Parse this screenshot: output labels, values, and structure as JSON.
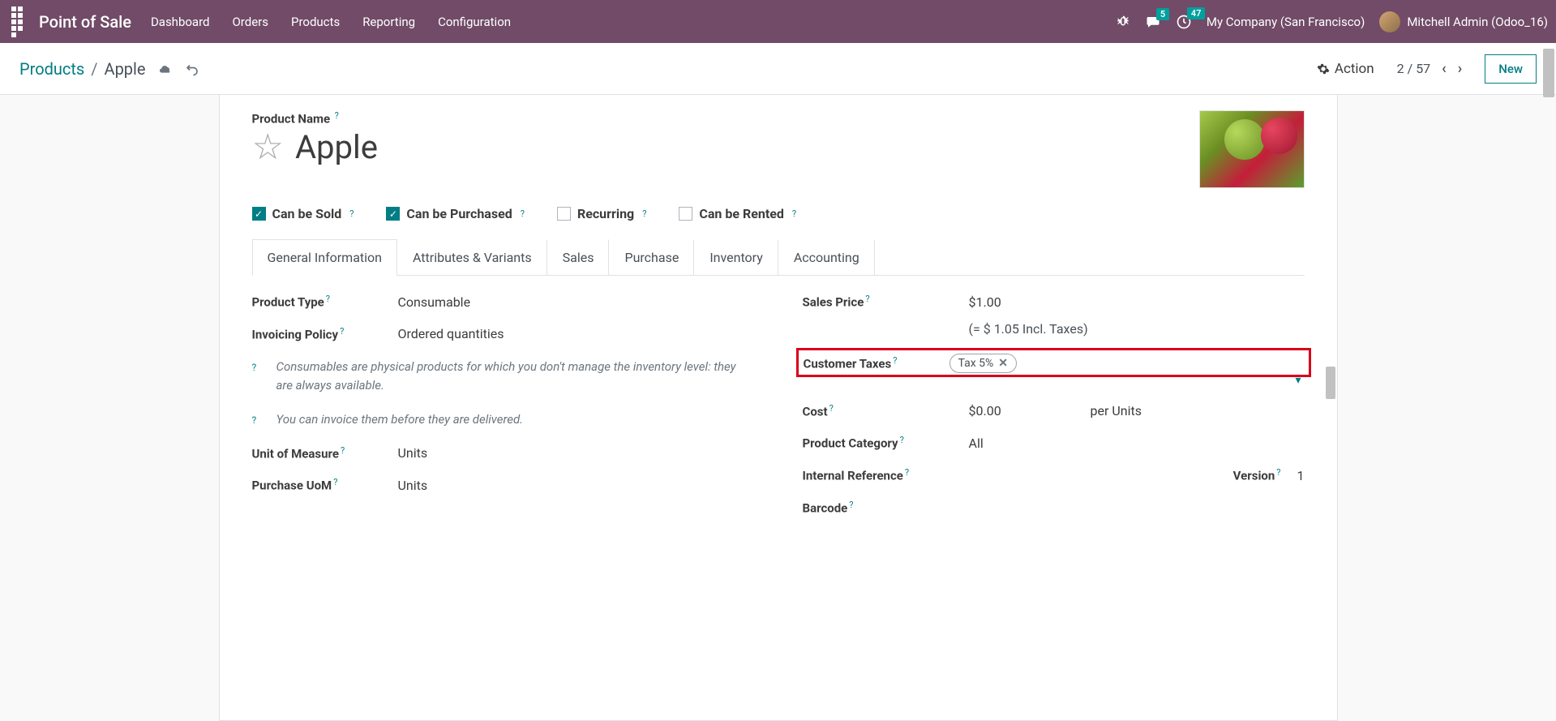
{
  "topnav": {
    "app_title": "Point of Sale",
    "menu": [
      "Dashboard",
      "Orders",
      "Products",
      "Reporting",
      "Configuration"
    ],
    "messages_badge": "5",
    "activities_badge": "47",
    "company": "My Company (San Francisco)",
    "user": "Mitchell Admin (Odoo_16)"
  },
  "controlbar": {
    "breadcrumb_root": "Products",
    "breadcrumb_current": "Apple",
    "action_label": "Action",
    "pager": "2 / 57",
    "new_label": "New"
  },
  "form": {
    "product_name_label": "Product Name",
    "product_name": "Apple",
    "checks": {
      "can_be_sold": "Can be Sold",
      "can_be_purchased": "Can be Purchased",
      "recurring": "Recurring",
      "can_be_rented": "Can be Rented"
    },
    "tabs": [
      "General Information",
      "Attributes & Variants",
      "Sales",
      "Purchase",
      "Inventory",
      "Accounting"
    ],
    "left": {
      "product_type_label": "Product Type",
      "product_type": "Consumable",
      "invoicing_policy_label": "Invoicing Policy",
      "invoicing_policy": "Ordered quantities",
      "hint1": "Consumables are physical products for which you don't manage the inventory level: they are always available.",
      "hint2": "You can invoice them before they are delivered.",
      "uom_label": "Unit of Measure",
      "uom": "Units",
      "purchase_uom_label": "Purchase UoM",
      "purchase_uom": "Units"
    },
    "right": {
      "sales_price_label": "Sales Price",
      "sales_price": "$1.00",
      "sales_price_incl": "(= $ 1.05 Incl. Taxes)",
      "customer_taxes_label": "Customer Taxes",
      "customer_taxes_tag": "Tax 5%",
      "cost_label": "Cost",
      "cost": "$0.00",
      "cost_per": "per Units",
      "category_label": "Product Category",
      "category": "All",
      "internal_ref_label": "Internal Reference",
      "version_label": "Version",
      "version": "1",
      "barcode_label": "Barcode"
    }
  }
}
